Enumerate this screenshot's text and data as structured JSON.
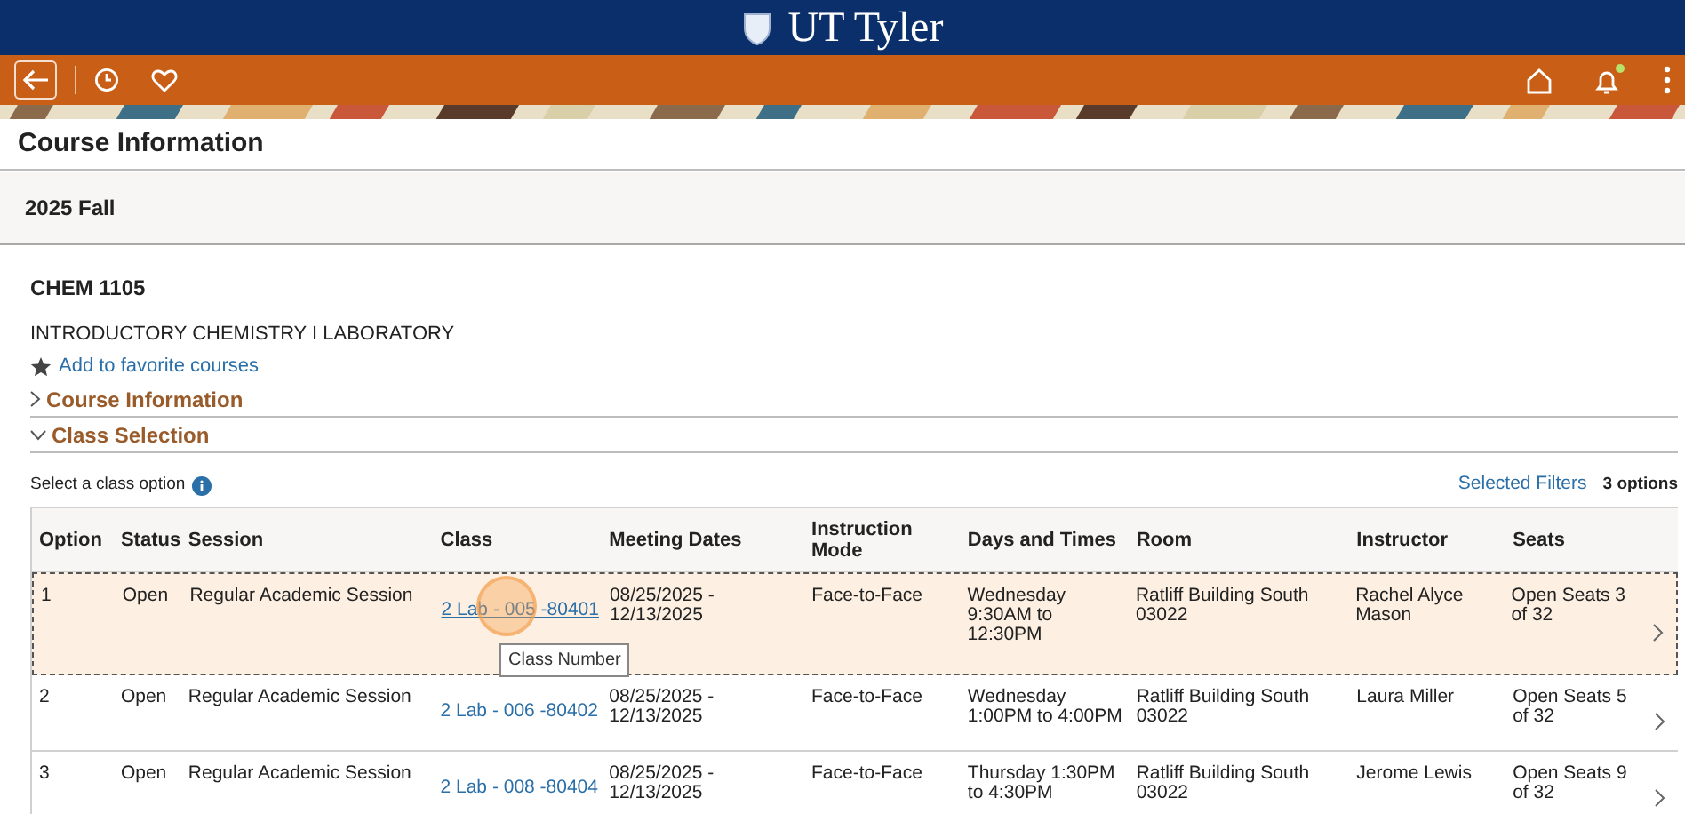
{
  "banner": {
    "logo_text": "UT Tyler"
  },
  "nav": {
    "notification_dot": true
  },
  "page_title": "Course Information",
  "term": "2025 Fall",
  "course": {
    "code": "CHEM 1105",
    "title": "INTRODUCTORY CHEMISTRY I LABORATORY",
    "favorite_link": "Add to favorite courses"
  },
  "sections": [
    {
      "label": "Course Information",
      "expanded": false
    },
    {
      "label": "Class Selection",
      "expanded": true
    }
  ],
  "class_selection": {
    "prompt": "Select a class option",
    "filters_link": "Selected Filters",
    "count": "3 options"
  },
  "table": {
    "columns": [
      "Option",
      "Status",
      "Session",
      "Class",
      "Meeting Dates",
      "Instruction Mode",
      "Days and Times",
      "Room",
      "Instructor",
      "Seats"
    ],
    "rows": [
      {
        "selected": true,
        "option": "1",
        "status": "Open",
        "session": "Regular Academic Session",
        "class": "2 Lab - 005 -80401",
        "dates": "08/25/2025 - 12/13/2025",
        "mode": "Face-to-Face",
        "days": "Wednesday 9:30AM to 12:30PM",
        "room": "Ratliff Building South 03022",
        "instructor": "Rachel Alyce Mason",
        "seats": "Open Seats 3 of 32"
      },
      {
        "selected": false,
        "option": "2",
        "status": "Open",
        "session": "Regular Academic Session",
        "class": "2 Lab - 006 -80402",
        "dates": "08/25/2025 - 12/13/2025",
        "mode": "Face-to-Face",
        "days": "Wednesday 1:00PM to 4:00PM",
        "room": "Ratliff Building South 03022",
        "instructor": "Laura Miller",
        "seats": "Open Seats 5 of 32"
      },
      {
        "selected": false,
        "option": "3",
        "status": "Open",
        "session": "Regular Academic Session",
        "class": "2 Lab - 008 -80404",
        "dates": "08/25/2025 - 12/13/2025",
        "mode": "Face-to-Face",
        "days": "Thursday 1:30PM to 4:30PM",
        "room": "Ratliff Building South 03022",
        "instructor": "Jerome Lewis",
        "seats": "Open Seats 9 of 32"
      }
    ]
  },
  "tooltip": "Class Number"
}
